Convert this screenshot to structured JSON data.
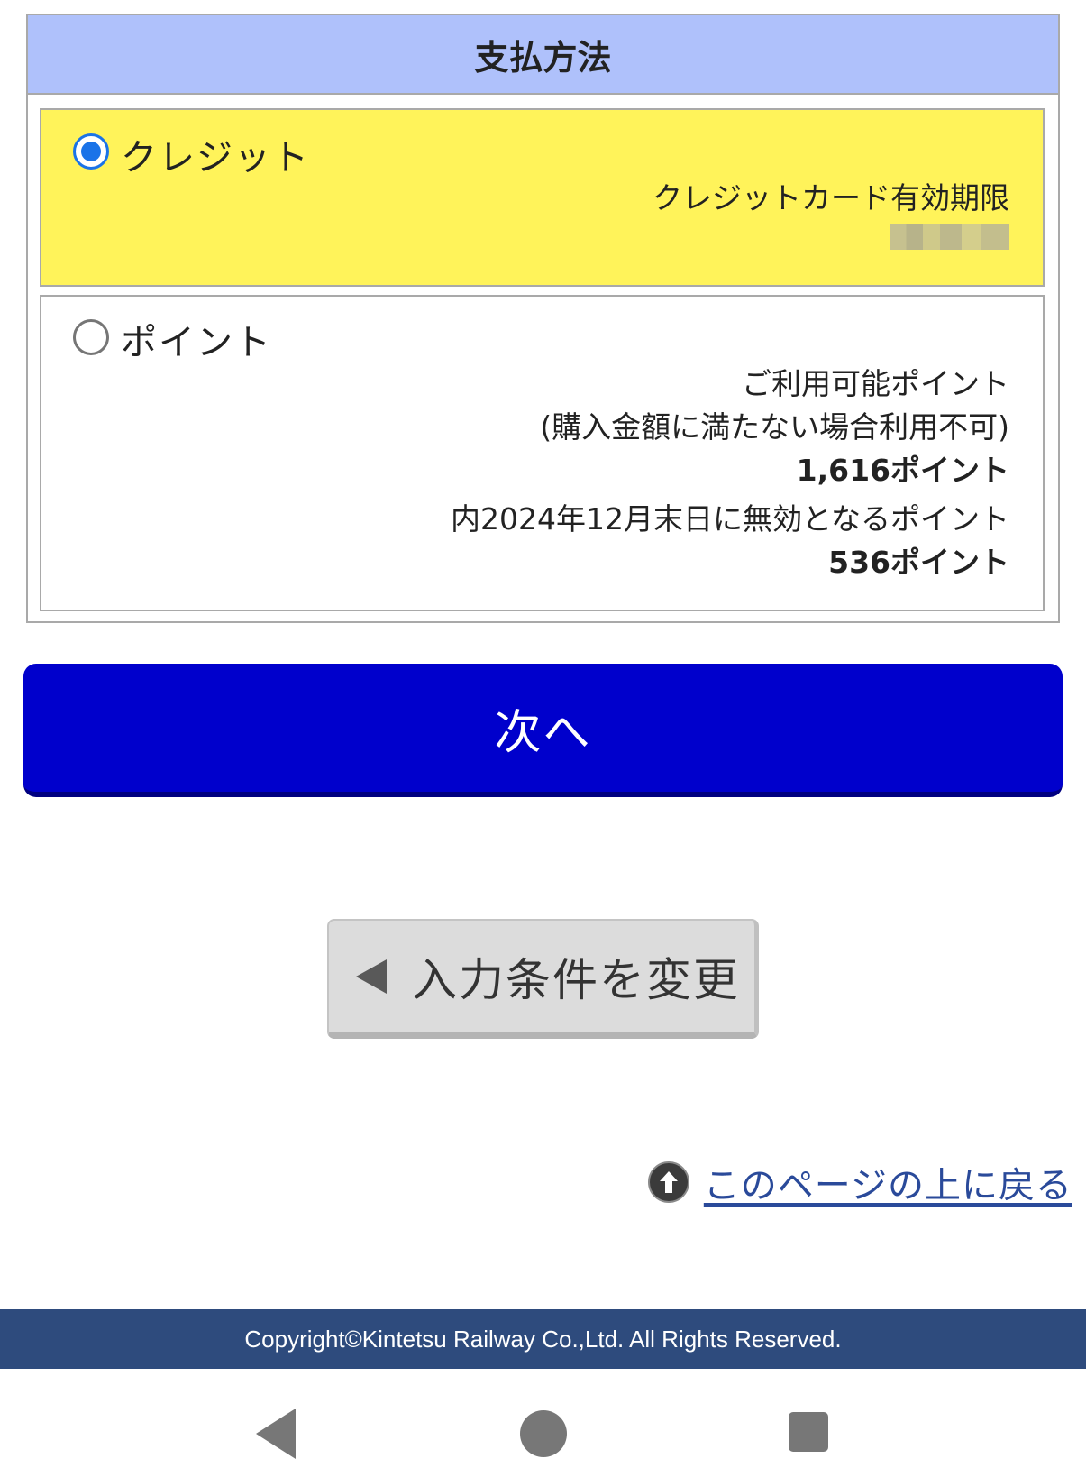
{
  "payment": {
    "title": "支払方法",
    "options": [
      {
        "label": "クレジット",
        "selected": true,
        "details": [
          {
            "text": "クレジットカード有効期限",
            "bold": false
          }
        ],
        "masked_value": true
      },
      {
        "label": "ポイント",
        "selected": false,
        "details": [
          {
            "text": "ご利用可能ポイント",
            "bold": false
          },
          {
            "text": "(購入金額に満たない場合利用不可)",
            "bold": false
          },
          {
            "text": "1,616ポイント",
            "bold": true
          },
          {
            "text": "内2024年12月末日に無効となるポイント",
            "bold": false
          },
          {
            "text": "536ポイント",
            "bold": true
          }
        ]
      }
    ]
  },
  "actions": {
    "next_label": "次へ",
    "change_label": "入力条件を変更"
  },
  "top_link": {
    "label": "このページの上に戻る",
    "icon": "arrow-up-circle-icon"
  },
  "footer": {
    "copyright": "Copyright©Kintetsu Railway Co.,Ltd. All Rights Reserved."
  },
  "nav_bar": {
    "icons": [
      "back-icon",
      "home-icon",
      "recent-apps-icon"
    ]
  },
  "colors": {
    "header_bg": "#afc1fb",
    "selected_bg": "#fff35a",
    "primary_button": "#0000cc",
    "footer_bg": "#2e4b7d",
    "link": "#2a4a9a"
  }
}
